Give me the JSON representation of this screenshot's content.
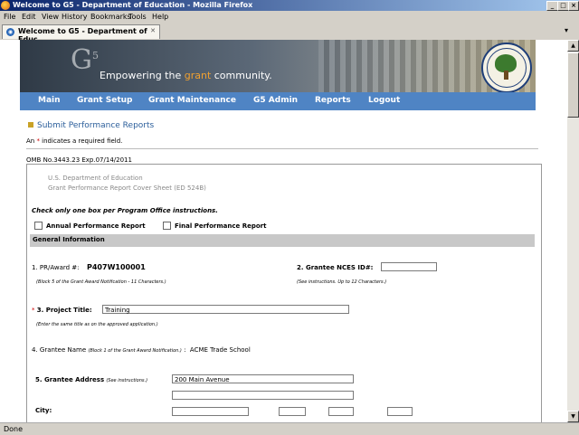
{
  "window": {
    "title": "Welcome to G5 - Department of Education - Mozilla Firefox"
  },
  "menubar": {
    "items": [
      "File",
      "Edit",
      "View",
      "History",
      "Bookmarks",
      "Tools",
      "Help"
    ]
  },
  "tab": {
    "label": "Welcome to G5 - Department of Educ..."
  },
  "banner": {
    "logo": "G",
    "logo_sup": "5",
    "tagline_pre": "Empowering the ",
    "tagline_accent": "grant",
    "tagline_post": " community.",
    "seal_text": "DEPARTMENT OF EDUCATION · UNITED STATES OF AMERICA"
  },
  "nav": {
    "items": [
      "Main",
      "Grant Setup",
      "Grant Maintenance",
      "G5 Admin",
      "Reports",
      "Logout"
    ]
  },
  "page": {
    "title": "Submit Performance Reports",
    "required_pre": "An ",
    "required_star": "*",
    "required_post": " indicates a required field.",
    "omb": "OMB No.3443.23 Exp.07/14/2011",
    "dept": "U.S. Department of Education",
    "form_title": "Grant Performance Report Cover Sheet (ED 524B)",
    "instruction": "Check only one box per Program Office instructions.",
    "annual_label": "Annual Performance Report",
    "final_label": "Final Performance Report",
    "section_header": "General Information",
    "pr_label": "1. PR/Award #:",
    "pr_value": "P407W100001",
    "pr_note": "(Block 5 of the Grant Award Notification - 11 Characters.)",
    "nces_label": "2. Grantee NCES ID#:",
    "nces_value": "",
    "nces_note": "(See instructions. Up to 12 Characters.)",
    "title_star": "*",
    "project_title_label": "3. Project Title:",
    "project_title_value": "Training",
    "project_title_note": "(Enter the same title as on the approved application.)",
    "grantee_name_label": "4. Grantee Name",
    "grantee_name_note": "(Block 1 of the Grant Award Notification.)",
    "grantee_name_colon": ":",
    "grantee_name_value": "ACME Trade School",
    "address_label": "5. Grantee Address",
    "address_note": "(See instructions.)",
    "address_line1": "200 Main Avenue",
    "address_line2": "",
    "city_label": "City:"
  },
  "status": {
    "text": "Done"
  }
}
